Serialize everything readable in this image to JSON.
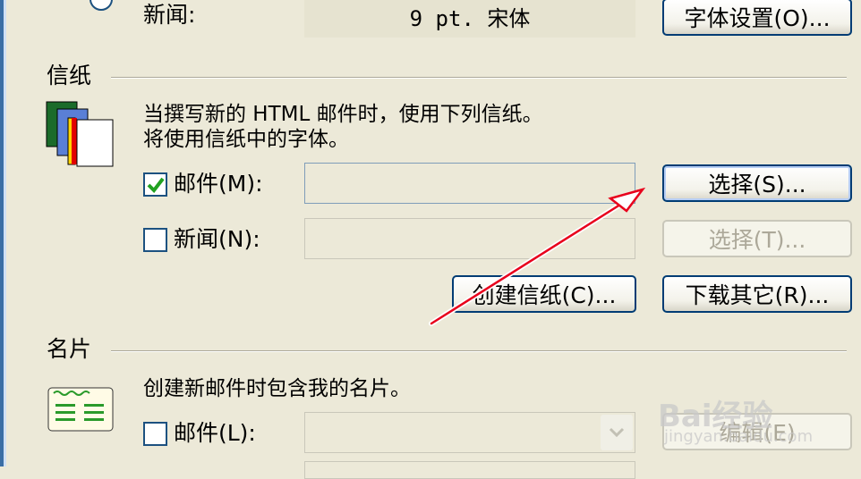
{
  "news_font": {
    "label": "新闻:",
    "value": "9 pt. 宋体",
    "button": "字体设置(O)..."
  },
  "stationery": {
    "title": "信纸",
    "description_line1": "当撰写新的 HTML 邮件时，使用下列信纸。",
    "description_line2": "将使用信纸中的字体。",
    "mail_checkbox_label": "邮件(M):",
    "mail_checked": true,
    "mail_value": "",
    "mail_select_button": "选择(S)...",
    "news_checkbox_label": "新闻(N):",
    "news_checked": false,
    "news_value": "",
    "news_select_button": "选择(T)...",
    "create_button": "创建信纸(C)...",
    "download_button": "下载其它(R)..."
  },
  "business_card": {
    "title": "名片",
    "description": "创建新邮件时包含我的名片。",
    "mail_checkbox_label": "邮件(L):",
    "mail_checked": false,
    "edit_button": "编辑(E)"
  },
  "watermark": {
    "brand": "Bai经验",
    "url": "jingyan.baidu.com"
  },
  "colors": {
    "background": "#ece9d8",
    "accent_arrow": "#e8001c",
    "button_border": "#003c74"
  }
}
